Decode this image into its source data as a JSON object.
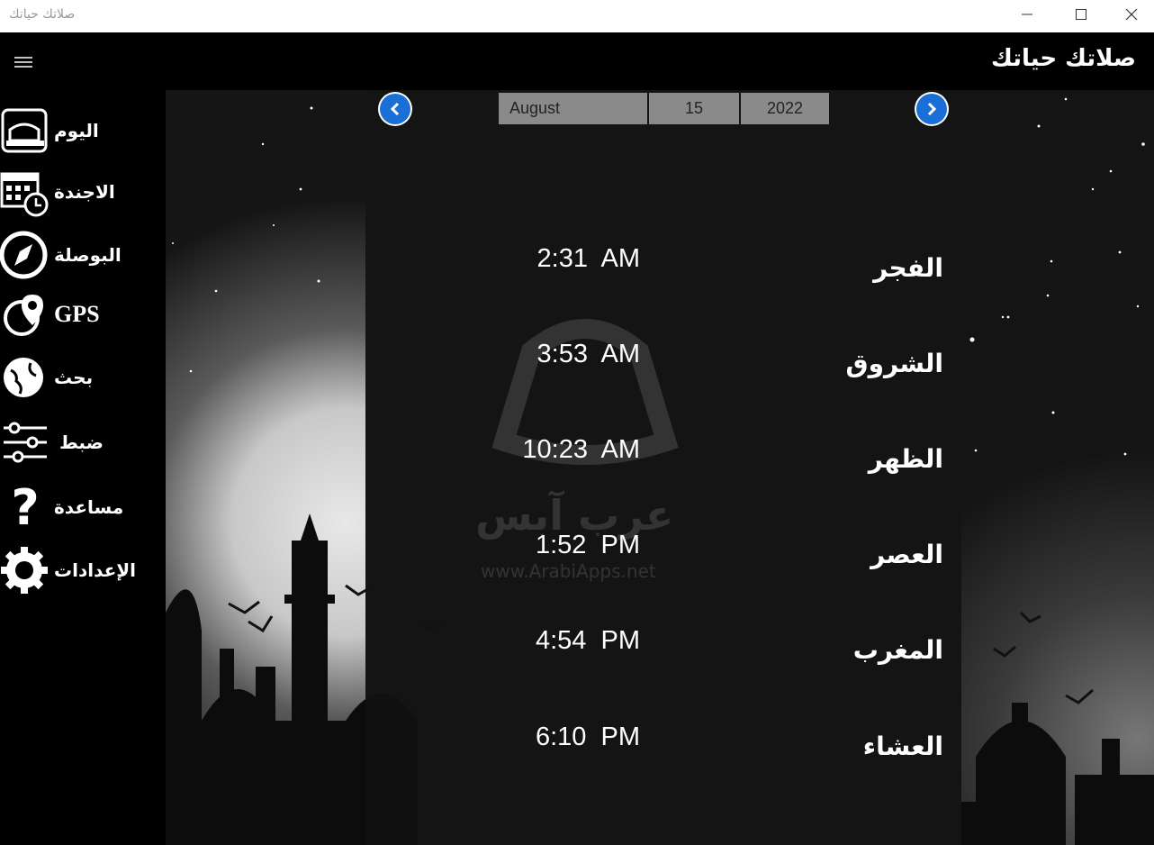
{
  "window": {
    "title": "صلاتك حياتك",
    "controls": {
      "minimize_icon": "minimize-icon",
      "maximize_icon": "maximize-icon",
      "close_icon": "close-icon"
    }
  },
  "header": {
    "app_title": "صلاتك حياتك",
    "menu_icon": "hamburger-icon"
  },
  "sidebar": {
    "items": [
      {
        "label": "اليوم",
        "icon": "mosque-calendar-icon"
      },
      {
        "label": "الاجندة",
        "icon": "calendar-clock-icon"
      },
      {
        "label": "البوصلة",
        "icon": "compass-icon"
      },
      {
        "label": "GPS",
        "icon": "globe-pin-icon"
      },
      {
        "label": "بحث",
        "icon": "globe-search-icon"
      },
      {
        "label": "ضبط",
        "icon": "sliders-icon"
      },
      {
        "label": "مساعدة",
        "icon": "question-icon"
      },
      {
        "label": "الإعدادات",
        "icon": "gear-icon"
      }
    ]
  },
  "date_picker": {
    "month": "August",
    "day": "15",
    "year": "2022",
    "prev_icon": "chevron-left-icon",
    "next_icon": "chevron-right-icon"
  },
  "prayers": [
    {
      "name": "الفجر",
      "time": "2:31  AM"
    },
    {
      "name": "الشروق",
      "time": "3:53  AM"
    },
    {
      "name": "الظهر",
      "time": "10:23  AM"
    },
    {
      "name": "العصر",
      "time": "1:52  PM"
    },
    {
      "name": "المغرب",
      "time": "4:54  PM"
    },
    {
      "name": "العشاء",
      "time": "6:10  PM"
    }
  ],
  "watermark": {
    "text": "عرب آبس",
    "url": "www.ArabiApps.net"
  },
  "colors": {
    "accent_blue": "#1a6fd6",
    "date_field_bg": "#8a8a8a",
    "background": "#000000",
    "text": "#ffffff"
  }
}
